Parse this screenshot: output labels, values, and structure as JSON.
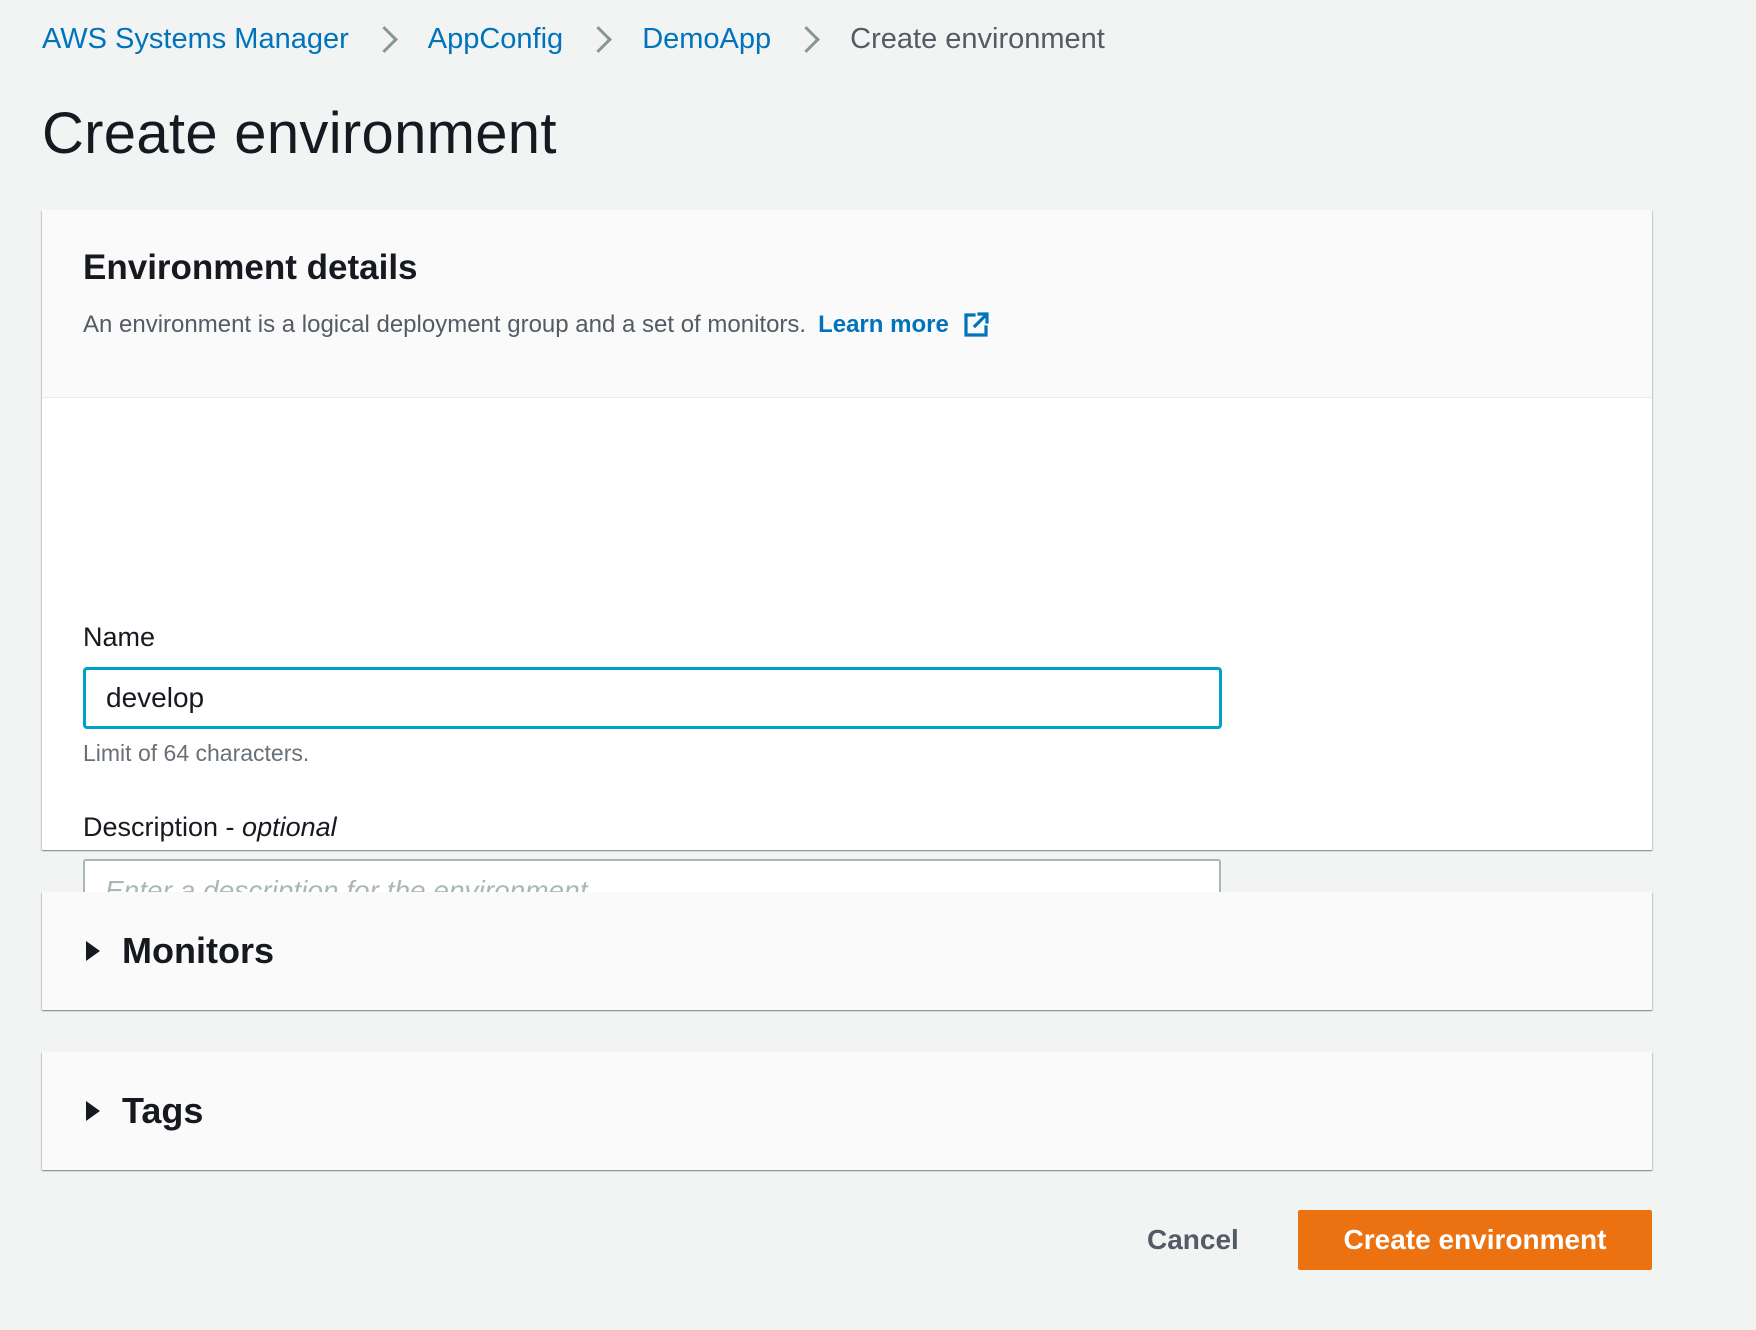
{
  "breadcrumb": {
    "items": [
      "AWS Systems Manager",
      "AppConfig",
      "DemoApp"
    ],
    "current": "Create environment"
  },
  "page": {
    "title": "Create environment"
  },
  "details": {
    "heading": "Environment details",
    "description": "An environment is a logical deployment group and a set of monitors.",
    "learn_more": "Learn more",
    "learn_more_icon": "external-link-icon",
    "name_label": "Name",
    "name_value": "develop",
    "name_hint": "Limit of 64 characters.",
    "description_label": "Description - ",
    "description_optional": "optional",
    "description_placeholder": "Enter a description for the environment."
  },
  "sections": {
    "monitors": "Monitors",
    "tags": "Tags"
  },
  "actions": {
    "cancel": "Cancel",
    "create": "Create environment"
  },
  "colors": {
    "link": "#0073bb",
    "primary_button": "#ec7211",
    "focus_border": "#00a1c9",
    "background": "#f2f3f3"
  }
}
